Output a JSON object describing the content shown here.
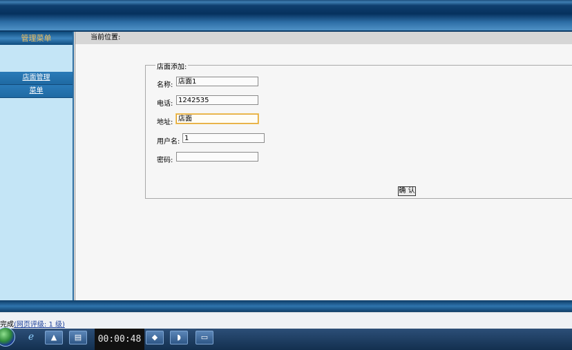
{
  "sidebar": {
    "header": "管理菜单",
    "items": [
      {
        "label": "店面管理"
      },
      {
        "label": "菜单"
      }
    ]
  },
  "breadcrumb": {
    "label": "当前位置:"
  },
  "form": {
    "legend": "店面添加:",
    "fields": [
      {
        "label": "名称:",
        "value": "店面1"
      },
      {
        "label": "电话:",
        "value": "1242535"
      },
      {
        "label": "地址:",
        "value": "店面"
      },
      {
        "label": "用户名:",
        "value": "1"
      },
      {
        "label": "密码:",
        "value": ""
      }
    ],
    "confirm_label": "确 认"
  },
  "status": {
    "done": "完成",
    "rating": "(网页评级: 1 级)"
  },
  "taskbar": {
    "timer": "00:00:48",
    "icons": [
      "ie-icon",
      "media-icon",
      "explorer-icon",
      "app-icon",
      "app2-icon",
      "window-icon"
    ]
  },
  "colors": {
    "banner": "#06315e",
    "sidebar": "#c4e5f6",
    "menu_header_text": "#f0c060",
    "focus_border": "#e0a12c"
  }
}
